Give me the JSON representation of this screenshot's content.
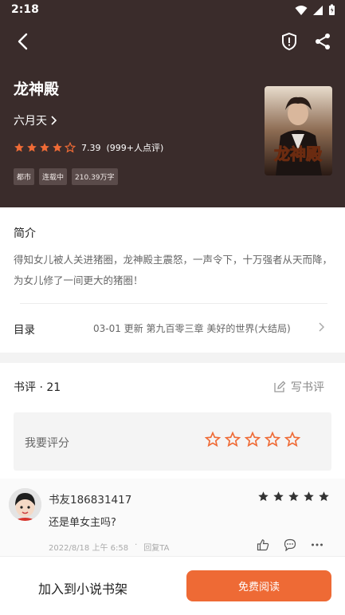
{
  "status": {
    "time": "2:18"
  },
  "book": {
    "title": "龙神殿",
    "author": "六月天",
    "rating_score": "7.39",
    "rating_count": "(999+人点评)",
    "rating_stars": 4,
    "tags": [
      "都市",
      "连载中",
      "210.39万字"
    ],
    "cover_text": "龙神殿"
  },
  "intro": {
    "title": "简介",
    "text": "得知女儿被人关进猪圈，龙神殿主震怒，一声令下，十万强者从天而降，为女儿修了一间更大的猪圈！"
  },
  "toc": {
    "label": "目录",
    "latest": "03-01  更新   第九百零三章 美好的世界(大结局)"
  },
  "reviews": {
    "title": "书评 · 21",
    "write_label": "写书评",
    "rate_label": "我要评分",
    "comment": {
      "user": "书友186831417",
      "text": "还是单女主吗?",
      "date": "2022/8/18 上午 6:58",
      "dot": "·",
      "reply": "回复TA",
      "stars": 5
    }
  },
  "bottom": {
    "add_shelf": "加入到小说书架",
    "read": "免费阅读"
  },
  "colors": {
    "hero_bg": "#3a2c2b",
    "accent": "#ee6a35",
    "star": "#ef6b36"
  }
}
